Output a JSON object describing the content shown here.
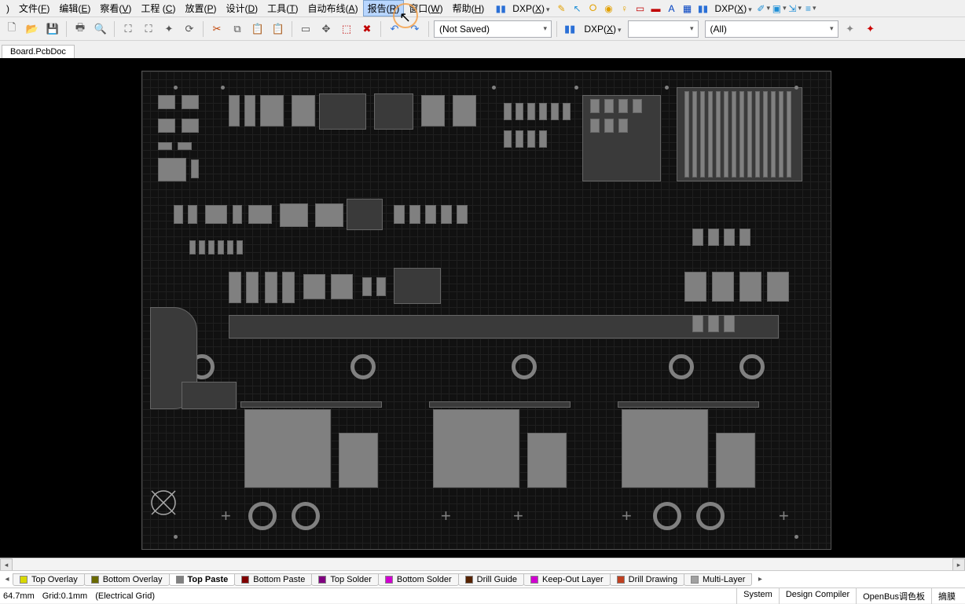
{
  "menu": {
    "items": [
      {
        "label": ")",
        "accel": ""
      },
      {
        "label": "文件",
        "accel": "F"
      },
      {
        "label": "编辑",
        "accel": "E"
      },
      {
        "label": "察看",
        "accel": "V"
      },
      {
        "label": "工程",
        "accel": "C"
      },
      {
        "label": "放置",
        "accel": "P"
      },
      {
        "label": "设计",
        "accel": "D"
      },
      {
        "label": "工具",
        "accel": "T"
      },
      {
        "label": "自动布线",
        "accel": "A"
      },
      {
        "label": "报告",
        "accel": "R",
        "highlight": true
      },
      {
        "label": "窗口",
        "accel": "W"
      },
      {
        "label": "帮助",
        "accel": "H"
      }
    ],
    "dxp1": "DXP(X)",
    "dxp2": "DXP(X)"
  },
  "toolbar2": {
    "saved_combo": "(Not Saved)",
    "dxp": "DXP(X)",
    "blank_combo": "",
    "all_combo": "(All)"
  },
  "doc_tab": "Board.PcbDoc",
  "layers": [
    {
      "label": "Top Overlay",
      "color": "#d8d800"
    },
    {
      "label": "Bottom Overlay",
      "color": "#6a6a00"
    },
    {
      "label": "Top Paste",
      "color": "#808080",
      "active": true
    },
    {
      "label": "Bottom Paste",
      "color": "#800000"
    },
    {
      "label": "Top Solder",
      "color": "#800080"
    },
    {
      "label": "Bottom Solder",
      "color": "#d000d0"
    },
    {
      "label": "Drill Guide",
      "color": "#552200"
    },
    {
      "label": "Keep-Out Layer",
      "color": "#d000d0"
    },
    {
      "label": "Drill Drawing",
      "color": "#c04020"
    },
    {
      "label": "Multi-Layer",
      "color": "#a0a0a0"
    }
  ],
  "status": {
    "coord": "64.7mm",
    "grid": "Grid:0.1mm",
    "gridtype": "(Electrical Grid)",
    "panels": [
      "System",
      "Design Compiler",
      "OpenBus调色板",
      "摘膜"
    ]
  },
  "icons": {
    "new": "□",
    "open": "📂",
    "save": "💾",
    "print": "🖶",
    "preview": "🔍",
    "cut": "✂",
    "copy": "⧉",
    "paste": "📋",
    "undo": "↶",
    "redo": "↷"
  }
}
